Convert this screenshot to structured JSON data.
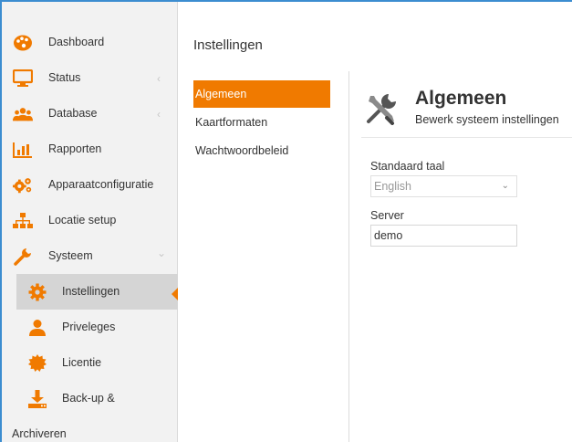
{
  "sidebar": {
    "items": [
      {
        "label": "Dashboard",
        "icon": "palette-icon"
      },
      {
        "label": "Status",
        "icon": "monitor-icon",
        "chevron": "‹"
      },
      {
        "label": "Database",
        "icon": "users-icon",
        "chevron": "‹"
      },
      {
        "label": "Rapporten",
        "icon": "bar-chart-icon"
      },
      {
        "label": "Apparaatconfiguratie",
        "icon": "cogs-icon"
      },
      {
        "label": "Locatie setup",
        "icon": "sitemap-icon"
      },
      {
        "label": "Systeem",
        "icon": "wrench-icon",
        "chevron": "⌄"
      }
    ],
    "sub_items": [
      {
        "label": "Instellingen",
        "icon": "gear-icon"
      },
      {
        "label": "Priveleges",
        "icon": "user-icon"
      },
      {
        "label": "Licentie",
        "icon": "certificate-icon"
      },
      {
        "label": "Back-up &",
        "icon": "download-icon"
      }
    ],
    "archiveren": "Archiveren"
  },
  "main": {
    "title": "Instellingen",
    "subnav": [
      "Algemeen",
      "Kaartformaten",
      "Wachtwoordbeleid"
    ],
    "section": {
      "title": "Algemeen",
      "subtitle": "Bewerk systeem instellingen"
    },
    "form": {
      "language_label": "Standaard taal",
      "language_value": "English",
      "server_label": "Server",
      "server_value": "demo"
    }
  },
  "colors": {
    "accent": "#f07a00",
    "frame": "#3c8dd0",
    "sidebar_bg": "#f2f2f2",
    "active_bg": "#d5d5d5"
  }
}
